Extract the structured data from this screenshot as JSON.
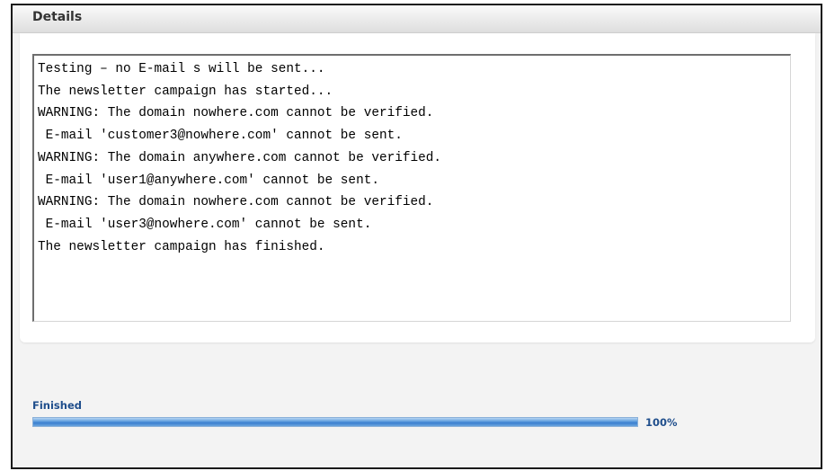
{
  "details": {
    "title": "Details",
    "log_lines": [
      "Testing – no E-mail s will be sent...",
      "The newsletter campaign has started...",
      "WARNING: The domain nowhere.com cannot be verified.",
      " E-mail 'customer3@nowhere.com' cannot be sent.",
      "WARNING: The domain anywhere.com cannot be verified.",
      " E-mail 'user1@anywhere.com' cannot be sent.",
      "WARNING: The domain nowhere.com cannot be verified.",
      " E-mail 'user3@nowhere.com' cannot be sent.",
      "The newsletter campaign has finished."
    ]
  },
  "progress": {
    "status_label": "Finished",
    "percent_text": "100%",
    "fraction": 1.0,
    "bar_color": "#3a7fd0",
    "text_color": "#1f4e8c"
  }
}
